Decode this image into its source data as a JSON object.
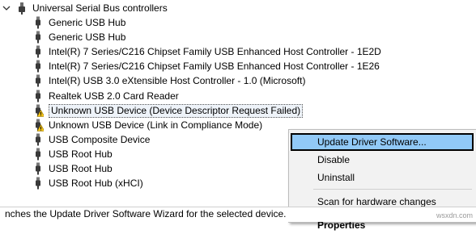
{
  "tree": {
    "category": "Universal Serial Bus controllers",
    "devices": [
      {
        "label": "Generic USB Hub",
        "warning": false
      },
      {
        "label": "Generic USB Hub",
        "warning": false
      },
      {
        "label": "Intel(R) 7 Series/C216 Chipset Family USB Enhanced Host Controller - 1E2D",
        "warning": false
      },
      {
        "label": "Intel(R) 7 Series/C216 Chipset Family USB Enhanced Host Controller - 1E26",
        "warning": false
      },
      {
        "label": "Intel(R) USB 3.0 eXtensible Host Controller - 1.0 (Microsoft)",
        "warning": false
      },
      {
        "label": "Realtek USB 2.0 Card Reader",
        "warning": false
      },
      {
        "label": "Unknown USB Device (Device Descriptor Request Failed)",
        "warning": true,
        "selected": true
      },
      {
        "label": "Unknown USB Device (Link in Compliance Mode)",
        "warning": true
      },
      {
        "label": "USB Composite Device",
        "warning": false
      },
      {
        "label": "USB Root Hub",
        "warning": false
      },
      {
        "label": "USB Root Hub",
        "warning": false
      },
      {
        "label": "USB Root Hub (xHCI)",
        "warning": false
      }
    ]
  },
  "context_menu": {
    "update_driver": "Update Driver Software...",
    "disable": "Disable",
    "uninstall": "Uninstall",
    "scan": "Scan for hardware changes",
    "properties": "Properties"
  },
  "status_bar": {
    "text": "nches the Update Driver Software Wizard for the selected device."
  },
  "watermark": "wsxdn.com",
  "colors": {
    "menu_highlight": "#91c9f7",
    "warning_yellow": "#f5c518",
    "selection_bg": "#eef3f9"
  }
}
